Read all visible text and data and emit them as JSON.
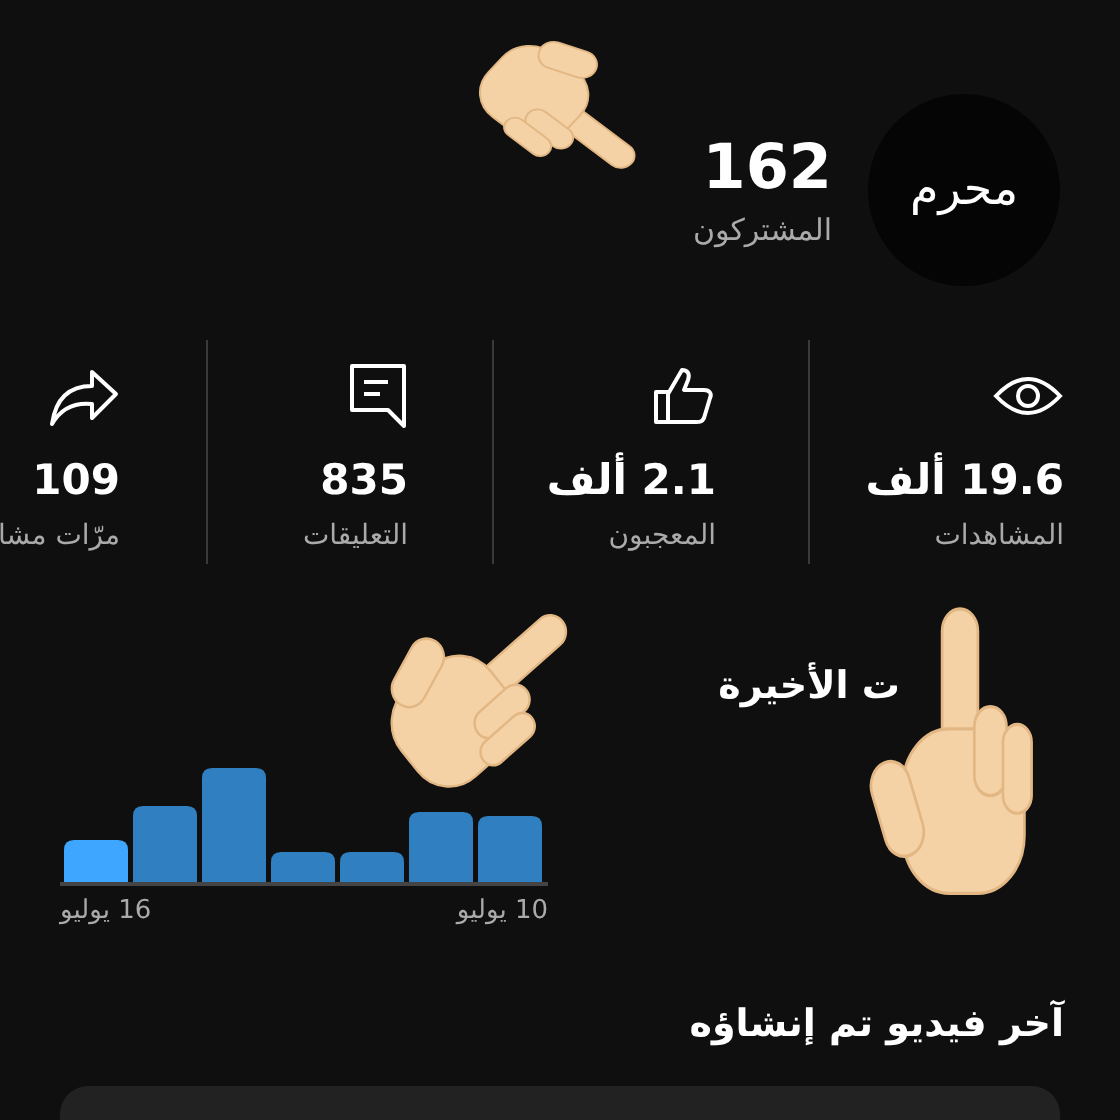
{
  "channel": {
    "avatar_text": "محرم",
    "subscribers": "162",
    "subscribers_label": "المشتركون"
  },
  "stats": [
    {
      "kind": "views",
      "value": "19.6 ألف",
      "label": "المشاهدات"
    },
    {
      "kind": "likes",
      "value": "2.1 ألف",
      "label": "المعجبون"
    },
    {
      "kind": "comments",
      "value": "835",
      "label": "التعليقات"
    },
    {
      "kind": "shares",
      "value": "109",
      "label": "مرّات مشا"
    }
  ],
  "recent": {
    "heading": "ت الأخيرة",
    "start_label": "10 يوليو",
    "end_label": "16 يوليو"
  },
  "latest_video": {
    "heading": "آخر فيديو تم إنشاؤه"
  }
}
